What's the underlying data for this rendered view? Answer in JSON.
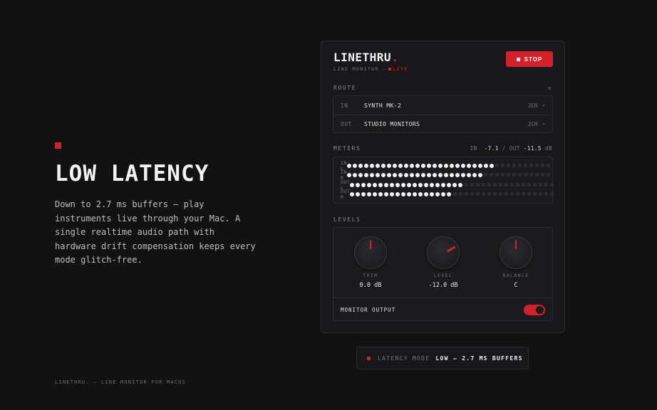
{
  "hero": {
    "headline": "LOW LATENCY",
    "body": "Down to 2.7 ms buffers — play instruments live through your Mac. A single realtime audio path with hardware drift compensation keeps every mode glitch-free.",
    "footer": "LINETHRU. — LINE MONITOR FOR MACOS"
  },
  "panel": {
    "brand": "LINETHRU",
    "brand_dot": ".",
    "subtitle_prefix": "LINE MONITOR —",
    "subtitle_live": "LIVE",
    "stop_label": "STOP",
    "colors": {
      "accent": "#d4202b",
      "background": "#121213",
      "panel": "#18181a"
    }
  },
  "route": {
    "label": "ROUTE",
    "settings_icon": "gear-icon",
    "rows": [
      {
        "tag": "IN",
        "value": "SYNTH MK-2",
        "channels": "2CH"
      },
      {
        "tag": "OUT",
        "value": "STUDIO MONITORS",
        "channels": "2CH"
      }
    ]
  },
  "meters": {
    "label": "METERS",
    "in_label": "IN",
    "in_value": "-7.1",
    "separator": "/",
    "out_label": "OUT",
    "out_value": "-11.5",
    "unit": "dB",
    "total_segments": 36,
    "rows": [
      {
        "label": "IN L",
        "lit": 26
      },
      {
        "label": "IN R",
        "lit": 24
      },
      {
        "label": "OUT L",
        "lit": 20
      },
      {
        "label": "OUT R",
        "lit": 18
      }
    ]
  },
  "levels": {
    "label": "LEVELS",
    "knobs": [
      {
        "label": "TRIM",
        "value": "0.0 dB",
        "angle": 0
      },
      {
        "label": "LEVEL",
        "value": "-12.0 dB",
        "angle": 60
      },
      {
        "label": "BALANCE",
        "value": "C",
        "angle": 0
      }
    ],
    "monitor_output_label": "MONITOR OUTPUT",
    "monitor_output_on": true
  },
  "mode": {
    "label": "LATENCY MODE",
    "value": "LOW — 2.7 MS BUFFERS"
  }
}
